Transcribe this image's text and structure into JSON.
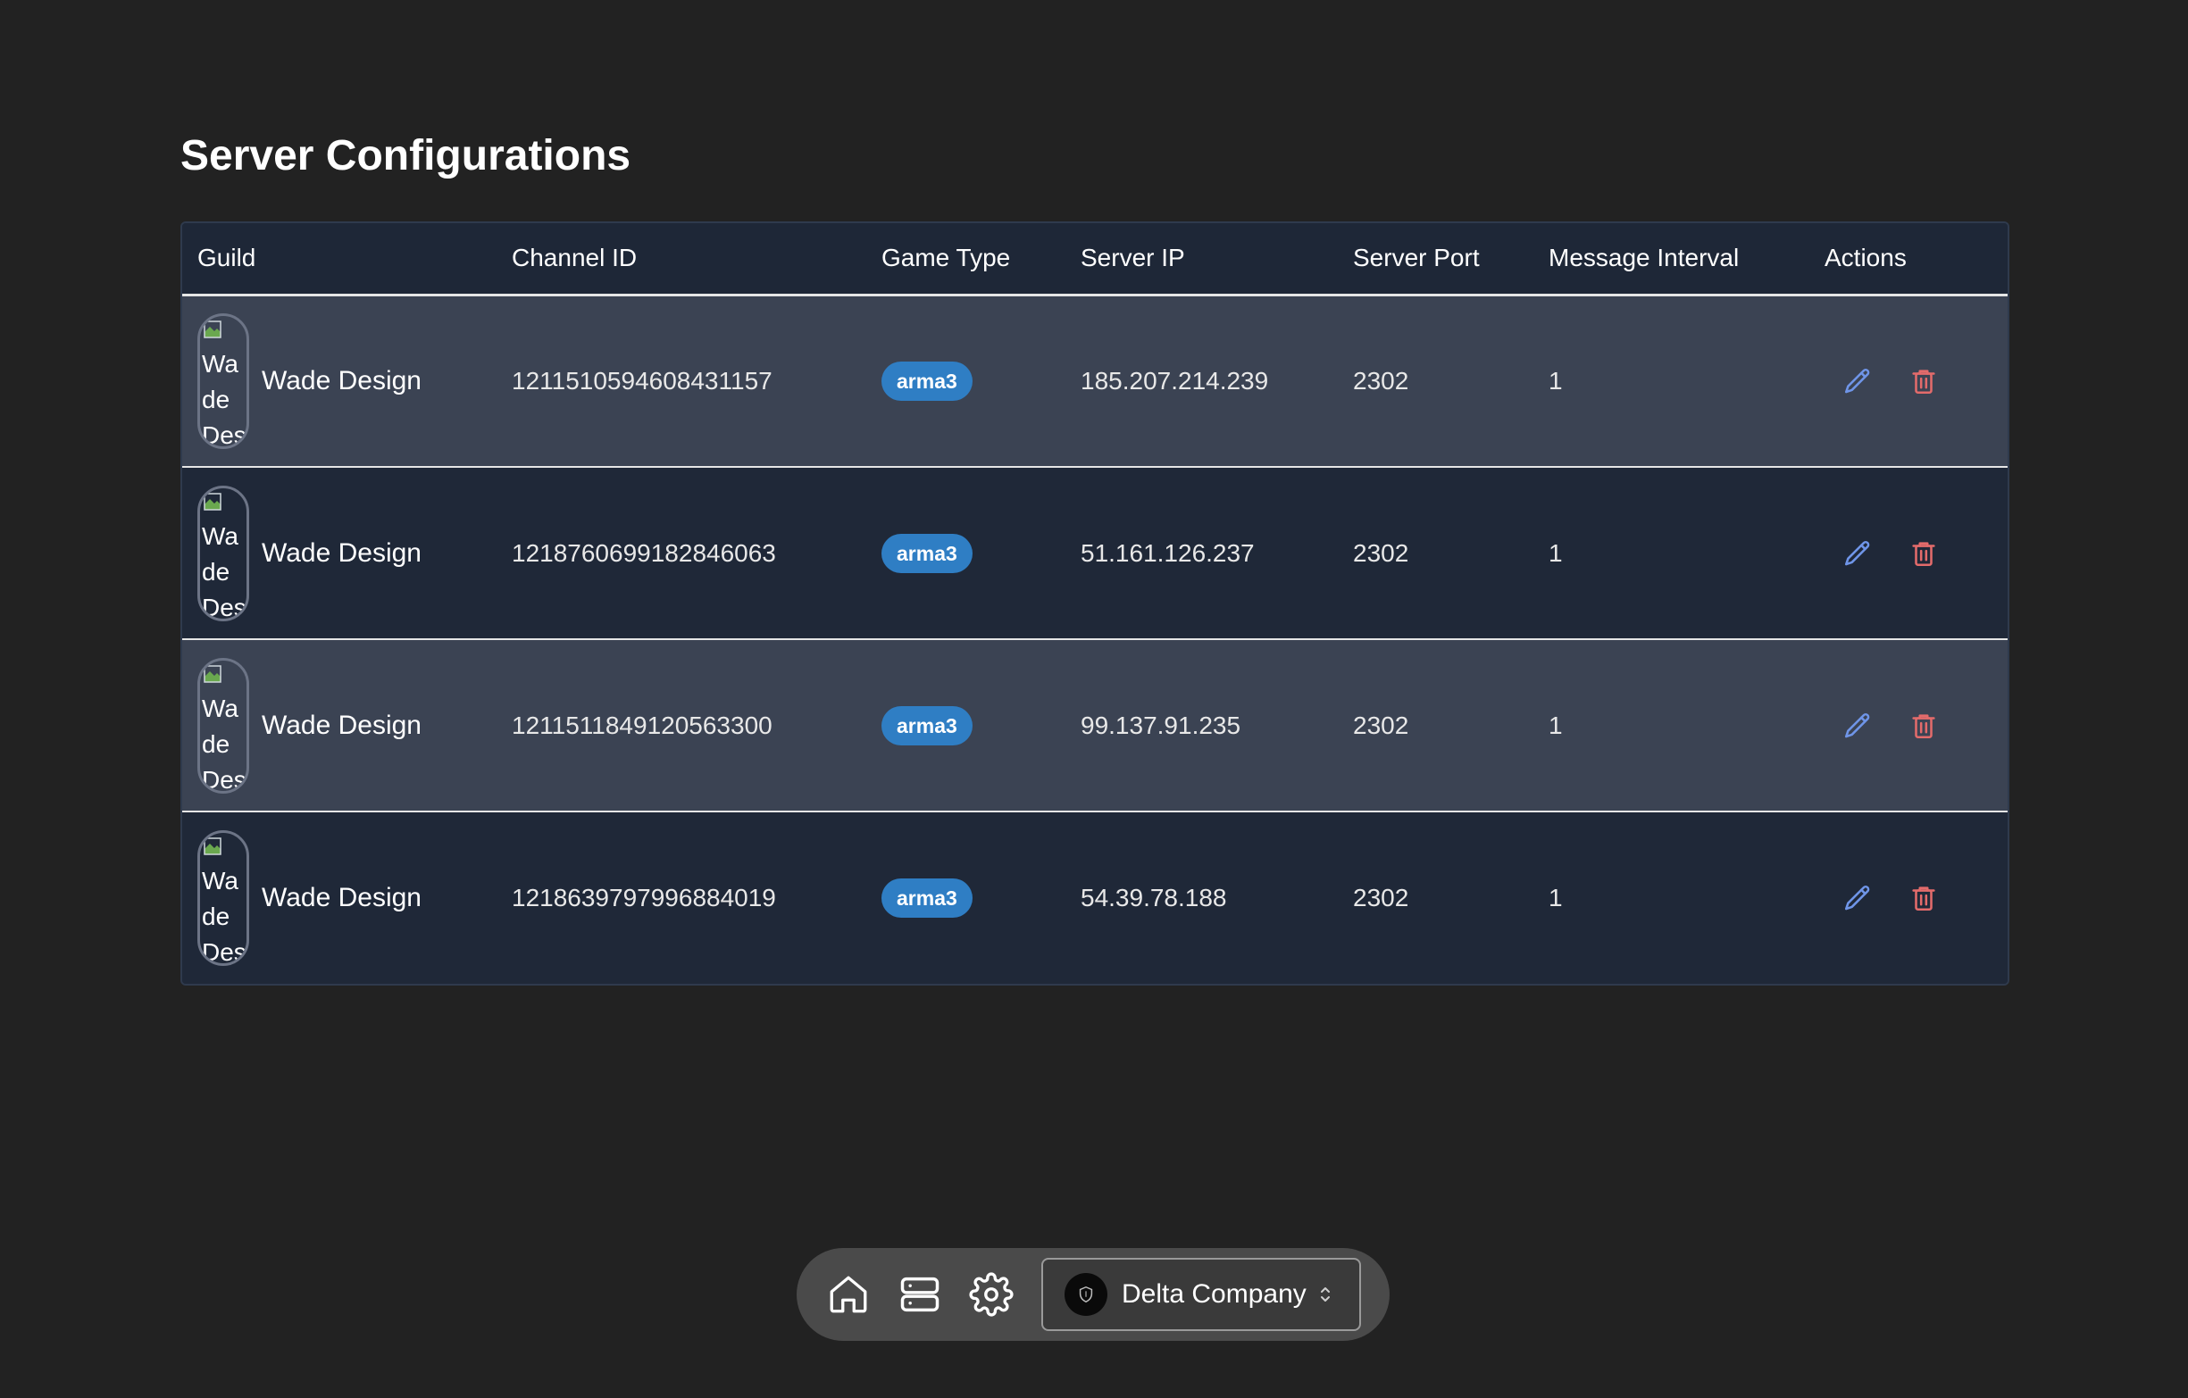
{
  "page": {
    "title": "Server Configurations"
  },
  "table": {
    "headers": [
      "Guild",
      "Channel ID",
      "Game Type",
      "Server IP",
      "Server Port",
      "Message Interval",
      "Actions"
    ],
    "rows": [
      {
        "guild_icon_alt": "Wade Design icon",
        "guild": "Wade Design",
        "channel_id": "1211510594608431157",
        "game_type": "arma3",
        "server_ip": "185.207.214.239",
        "server_port": "2302",
        "message_interval": "1"
      },
      {
        "guild_icon_alt": "Wade Design icon",
        "guild": "Wade Design",
        "channel_id": "1218760699182846063",
        "game_type": "arma3",
        "server_ip": "51.161.126.237",
        "server_port": "2302",
        "message_interval": "1"
      },
      {
        "guild_icon_alt": "Wade Design icon",
        "guild": "Wade Design",
        "channel_id": "1211511849120563300",
        "game_type": "arma3",
        "server_ip": "99.137.91.235",
        "server_port": "2302",
        "message_interval": "1"
      },
      {
        "guild_icon_alt": "Wade Design icon",
        "guild": "Wade Design",
        "channel_id": "1218639797996884019",
        "game_type": "arma3",
        "server_ip": "54.39.78.188",
        "server_port": "2302",
        "message_interval": "1"
      }
    ]
  },
  "actions": {
    "edit_icon": "pencil-icon",
    "delete_icon": "trash-icon"
  },
  "dock": {
    "icons": [
      "home-icon",
      "server-icon",
      "gear-icon"
    ],
    "company_select": {
      "selected": "Delta Company",
      "logo_icon": "shield-icon",
      "chevron_icon": "chevron-up-down-icon"
    }
  },
  "colors": {
    "background": "#222222",
    "badge": "#2f7ec4",
    "edit_icon": "#6f95e8",
    "delete_icon": "#e36b6b",
    "row_alt": "#3b4353",
    "row_base": "#1f2838"
  }
}
